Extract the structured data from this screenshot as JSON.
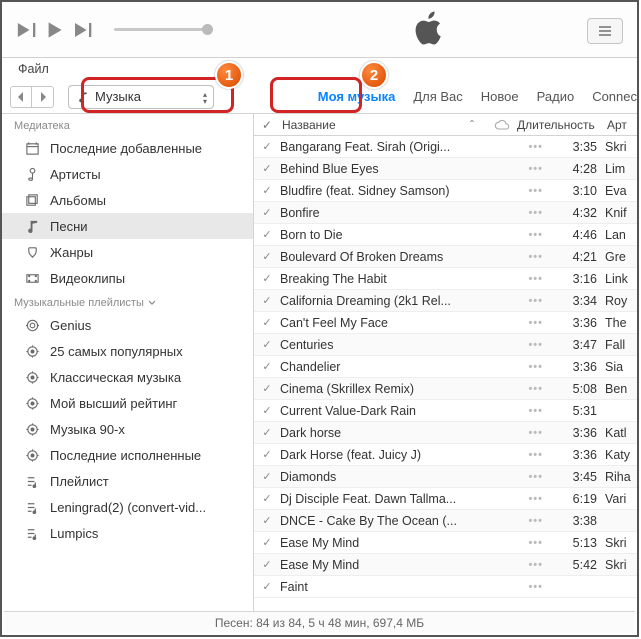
{
  "menubar": {
    "file": "Файл"
  },
  "category_selector": {
    "label": "Музыка"
  },
  "tabs": {
    "my_music": "Моя музыка",
    "for_you": "Для Вас",
    "new_": "Новое",
    "radio": "Радио",
    "connect": "Connec"
  },
  "callouts": {
    "one": "1",
    "two": "2"
  },
  "sidebar": {
    "section_library": "Медиатека",
    "section_playlists": "Музыкальные плейлисты",
    "library": [
      {
        "id": "recently-added",
        "label": "Последние добавленные"
      },
      {
        "id": "artists",
        "label": "Артисты"
      },
      {
        "id": "albums",
        "label": "Альбомы"
      },
      {
        "id": "songs",
        "label": "Песни",
        "selected": true
      },
      {
        "id": "genres",
        "label": "Жанры"
      },
      {
        "id": "videos",
        "label": "Видеоклипы"
      }
    ],
    "playlists": [
      {
        "id": "genius",
        "label": "Genius"
      },
      {
        "id": "top25",
        "label": "25 самых популярных"
      },
      {
        "id": "classical",
        "label": "Классическая музыка"
      },
      {
        "id": "my-top-rated",
        "label": "Мой высший рейтинг"
      },
      {
        "id": "90s",
        "label": "Музыка 90-х"
      },
      {
        "id": "recently-played",
        "label": "Последние исполненные"
      },
      {
        "id": "playlist",
        "label": "Плейлист"
      },
      {
        "id": "leningrad",
        "label": "Leningrad(2) (convert-vid..."
      },
      {
        "id": "lumpics",
        "label": "Lumpics"
      }
    ]
  },
  "table": {
    "header": {
      "name": "Название",
      "duration": "Длительность",
      "artist": "Арт"
    },
    "rows": [
      {
        "name": "Bangarang Feat. Sirah (Origi...",
        "dur": "3:35",
        "art": "Skri"
      },
      {
        "name": "Behind Blue Eyes",
        "dur": "4:28",
        "art": "Lim"
      },
      {
        "name": "Bludfire (feat. Sidney Samson)",
        "dur": "3:10",
        "art": "Eva"
      },
      {
        "name": "Bonfire",
        "dur": "4:32",
        "art": "Knif"
      },
      {
        "name": "Born to Die",
        "dur": "4:46",
        "art": "Lan"
      },
      {
        "name": "Boulevard Of Broken Dreams",
        "dur": "4:21",
        "art": "Gre"
      },
      {
        "name": "Breaking The Habit",
        "dur": "3:16",
        "art": "Link"
      },
      {
        "name": "California Dreaming (2k1 Rel...",
        "dur": "3:34",
        "art": "Roy"
      },
      {
        "name": "Can't Feel My Face",
        "dur": "3:36",
        "art": "The"
      },
      {
        "name": "Centuries",
        "dur": "3:47",
        "art": "Fall"
      },
      {
        "name": "Chandelier",
        "dur": "3:36",
        "art": "Sia"
      },
      {
        "name": "Cinema (Skrillex Remix)",
        "dur": "5:08",
        "art": "Ben"
      },
      {
        "name": "Current Value-Dark Rain",
        "dur": "5:31",
        "art": ""
      },
      {
        "name": "Dark horse",
        "dur": "3:36",
        "art": "Katl"
      },
      {
        "name": "Dark Horse (feat. Juicy J)",
        "dur": "3:36",
        "art": "Katy"
      },
      {
        "name": "Diamonds",
        "dur": "3:45",
        "art": "Riha"
      },
      {
        "name": "Dj Disciple Feat. Dawn Tallma...",
        "dur": "6:19",
        "art": "Vari"
      },
      {
        "name": "DNCE - Cake By The Ocean (...",
        "dur": "3:38",
        "art": ""
      },
      {
        "name": "Ease My Mind",
        "dur": "5:13",
        "art": "Skri"
      },
      {
        "name": "Ease My Mind",
        "dur": "5:42",
        "art": "Skri"
      },
      {
        "name": "Faint",
        "dur": "",
        "art": ""
      }
    ]
  },
  "status": "Песен: 84 из 84, 5 ч 48 мин, 697,4 МБ"
}
